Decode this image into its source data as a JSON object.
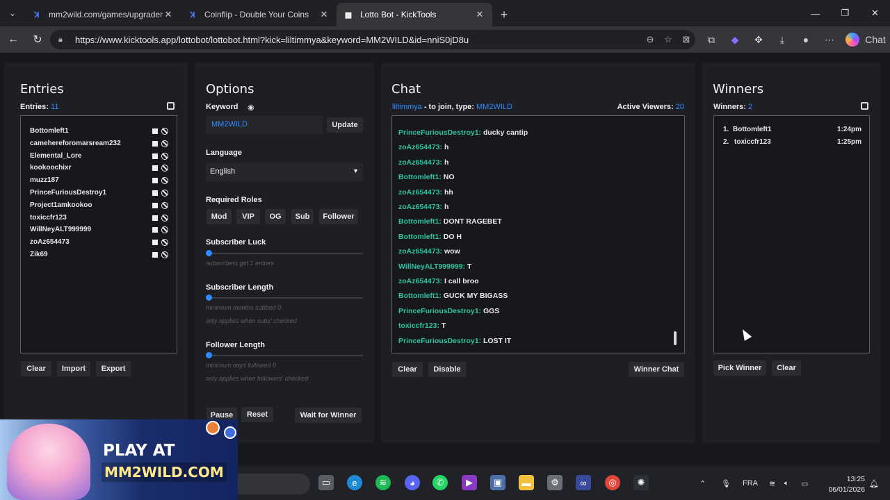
{
  "browser": {
    "tabs": [
      {
        "title": "mm2wild.com/games/upgrader",
        "active": false
      },
      {
        "title": "Coinflip - Double Your Coins",
        "active": false
      },
      {
        "title": "Lotto Bot - KickTools",
        "active": true
      }
    ],
    "url": "https://www.kicktools.app/lottobot/lottobot.html?kick=liltimmya&keyword=MM2WILD&id=nniS0jD8u",
    "chat_label": "Chat"
  },
  "entries": {
    "title": "Entries",
    "count_label": "Entries:",
    "count": "11",
    "list": [
      "Bottomleft1",
      "camehereforomarsream232",
      "Elemental_Lore",
      "kookoochixr",
      "muzz187",
      "PrinceFuriousDestroy1",
      "Project1amkookoo",
      "toxiccfr123",
      "WillNeyALT999999",
      "zoAz654473",
      "Zik69"
    ],
    "buttons": {
      "clear": "Clear",
      "import": "Import",
      "export": "Export"
    }
  },
  "options": {
    "title": "Options",
    "keyword_label": "Keyword",
    "keyword_value": "MM2WILD",
    "update": "Update",
    "language_label": "Language",
    "language_value": "English",
    "roles_label": "Required Roles",
    "roles": [
      "Mod",
      "VIP",
      "OG",
      "Sub",
      "Follower"
    ],
    "sub_luck_label": "Subscriber Luck",
    "sub_luck_hint": "subscribers get 1 entries",
    "sub_length_label": "Subscriber Length",
    "sub_length_hint1": "minimum months subbed 0",
    "sub_length_hint2": "only applies when subs' checked",
    "follower_length_label": "Follower Length",
    "follower_length_hint1": "minimum days followed 0",
    "follower_length_hint2": "only applies when followers' checked",
    "pause": "Pause",
    "reset": "Reset",
    "wait": "Wait for Winner"
  },
  "chat": {
    "title": "Chat",
    "channel": "liltimmya",
    "join_text": " - to join, type: ",
    "keyword": "MM2WILD",
    "active_label": "Active Viewers:",
    "active_count": "20",
    "messages": [
      {
        "user": "PrinceFuriousDestroy1:",
        "text": "ducky cantip"
      },
      {
        "user": "zoAz654473:",
        "text": "h"
      },
      {
        "user": "zoAz654473:",
        "text": "h"
      },
      {
        "user": "Bottomleft1:",
        "text": "NO"
      },
      {
        "user": "zoAz654473:",
        "text": "hh"
      },
      {
        "user": "zoAz654473:",
        "text": "h"
      },
      {
        "user": "Bottomleft1:",
        "text": "DONT RAGEBET"
      },
      {
        "user": "Bottomleft1:",
        "text": "DO H"
      },
      {
        "user": "zoAz654473:",
        "text": "wow"
      },
      {
        "user": "WillNeyALT999999:",
        "text": "T"
      },
      {
        "user": "zoAz654473:",
        "text": "I call broo"
      },
      {
        "user": "Bottomleft1:",
        "text": "GUCK MY BIGASS"
      },
      {
        "user": "PrinceFuriousDestroy1:",
        "text": "GGS"
      },
      {
        "user": "toxiccfr123:",
        "text": "T"
      },
      {
        "user": "PrinceFuriousDestroy1:",
        "text": "LOST IT"
      }
    ],
    "buttons": {
      "clear": "Clear",
      "disable": "Disable",
      "winner_chat": "Winner Chat"
    }
  },
  "winners": {
    "title": "Winners",
    "count_label": "Winners:",
    "count": "2",
    "list": [
      {
        "rank": "1.",
        "name": "Bottomleft1",
        "time": "1:24pm"
      },
      {
        "rank": "2.",
        "name": "toxiccfr123",
        "time": "1:25pm"
      }
    ],
    "buttons": {
      "pick": "Pick Winner",
      "clear": "Clear"
    }
  },
  "ad": {
    "line1": "PLAY AT",
    "line2": "MM2WILD.COM"
  },
  "taskbar": {
    "lang": "FRA",
    "time": "13:25",
    "date": "06/01/2026"
  },
  "colors": {
    "accent": "#2f8cff",
    "chat_user": "#2ec3a0",
    "panel": "#1e1f24"
  }
}
